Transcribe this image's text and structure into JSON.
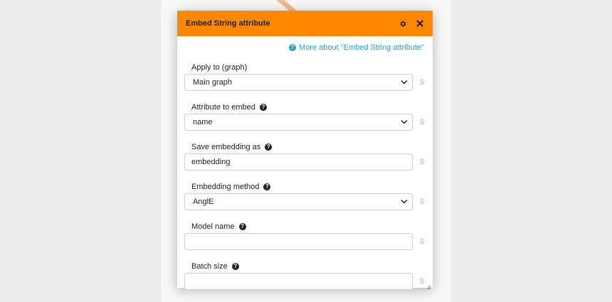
{
  "dialog": {
    "title": "Embed String attribute",
    "more_link": "More about \"Embed String attribute\""
  },
  "fields": [
    {
      "label": "Apply to (graph)",
      "value": "Main graph",
      "kind": "select",
      "help": false
    },
    {
      "label": "Attribute to embed",
      "value": "name",
      "kind": "select",
      "help": true
    },
    {
      "label": "Save embedding as",
      "value": "embedding",
      "kind": "input",
      "help": true
    },
    {
      "label": "Embedding method",
      "value": "AnglE",
      "kind": "select",
      "help": true
    },
    {
      "label": "Model name",
      "value": "",
      "kind": "input",
      "help": true
    },
    {
      "label": "Batch size",
      "value": "",
      "kind": "input",
      "help": true
    }
  ],
  "parameter_marker": "$",
  "help_glyph": "?",
  "colors": {
    "titlebar": "#ff8800",
    "link": "#29a0cf",
    "dollar": "#c4c4c4"
  },
  "icons": {
    "settings": "gear-icon",
    "close": "close-icon",
    "dropdown": "chevron-down-icon",
    "help": "question-circle-icon"
  }
}
